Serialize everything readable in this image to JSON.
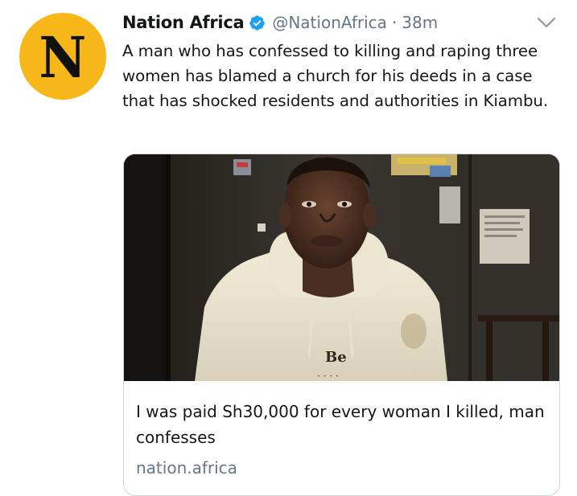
{
  "tweet": {
    "display_name": "Nation Africa",
    "handle": "@NationAfrica",
    "separator": "·",
    "timestamp": "38m",
    "text": "A man who has confessed to killing and raping three women has blamed a church for his deeds in a case that has shocked residents and authorities in Kiambu.",
    "verified": true
  },
  "avatar": {
    "letter": "N",
    "background_color": "#f7b718"
  },
  "card": {
    "title": "I was paid Sh30,000 for every woman I killed, man confesses",
    "domain": "nation.africa",
    "image_alt": "Photo of a man in a cream hooded sweatshirt standing in a dim room",
    "hoodie_text": "Be"
  },
  "icons": {
    "verified": "verified-badge-icon",
    "caret": "chevron-down-icon"
  },
  "colors": {
    "verified_blue": "#1da1f2",
    "secondary_text": "#657786",
    "primary_text": "#14171a",
    "card_border": "#ccd6dd"
  }
}
